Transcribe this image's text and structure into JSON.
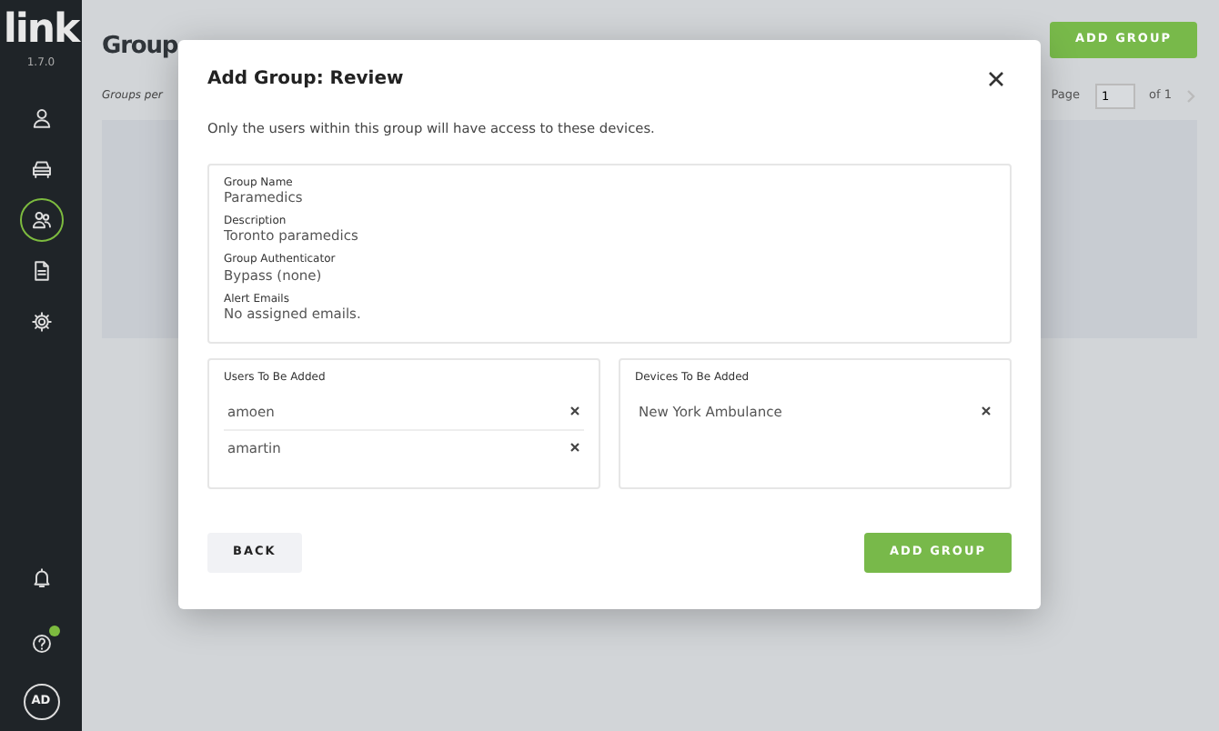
{
  "sidebar": {
    "logo": "link",
    "version": "1.7.0",
    "nav_items": [
      {
        "kind": "user",
        "selected": false
      },
      {
        "kind": "car",
        "selected": false
      },
      {
        "kind": "group",
        "selected": true
      },
      {
        "kind": "document",
        "selected": false
      },
      {
        "kind": "gear",
        "selected": false
      }
    ],
    "bottom_items": [
      {
        "kind": "bell",
        "notification": false
      },
      {
        "kind": "help",
        "notification": true
      }
    ],
    "avatar": "AD"
  },
  "page": {
    "title": "Group",
    "add_button": "ADD GROUP",
    "per_page_label": "Groups per",
    "pagination": {
      "label": "Page",
      "value": "1",
      "total": "of 1"
    }
  },
  "modal": {
    "title": "Add Group: Review",
    "subtitle": "Only the users within this group will have access to these devices.",
    "details": [
      {
        "label": "Group Name",
        "value": "Paramedics"
      },
      {
        "label": "Description",
        "value": "Toronto paramedics"
      },
      {
        "label": "Group Authenticator",
        "value": "Bypass (none)"
      },
      {
        "label": "Alert Emails",
        "value": "No assigned emails."
      }
    ],
    "users": {
      "heading": "Users To Be Added",
      "items": [
        "amoen",
        "amartin"
      ]
    },
    "devices": {
      "heading": "Devices To Be Added",
      "items": [
        "New York Ambulance"
      ]
    },
    "back_button": "BACK",
    "submit_button": "ADD GROUP"
  }
}
